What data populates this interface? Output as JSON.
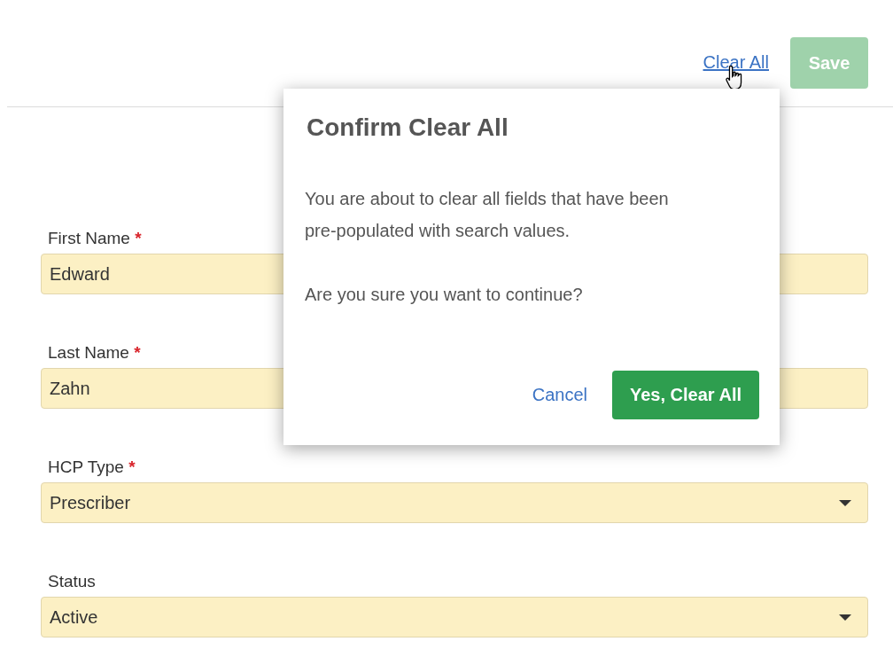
{
  "header": {
    "clear_all": "Clear All",
    "save": {
      "label": "Save",
      "disabled": true
    }
  },
  "fields": [
    {
      "kind": "text",
      "label": "First Name",
      "required_mark": "*",
      "value": "Edward"
    },
    {
      "kind": "text",
      "label": "Last Name",
      "required_mark": "*",
      "value": "Zahn"
    },
    {
      "kind": "select",
      "label": "HCP Type",
      "required_mark": "*",
      "value": "Prescriber"
    },
    {
      "kind": "select",
      "label": "Status",
      "value": "Active"
    }
  ],
  "dialog": {
    "title": "Confirm Clear All",
    "paragraphs": [
      "You are about to clear all fields that have been pre-populated with search values.",
      "Are you sure you want to continue?"
    ],
    "cancel": "Cancel",
    "confirm": "Yes, Clear All"
  }
}
